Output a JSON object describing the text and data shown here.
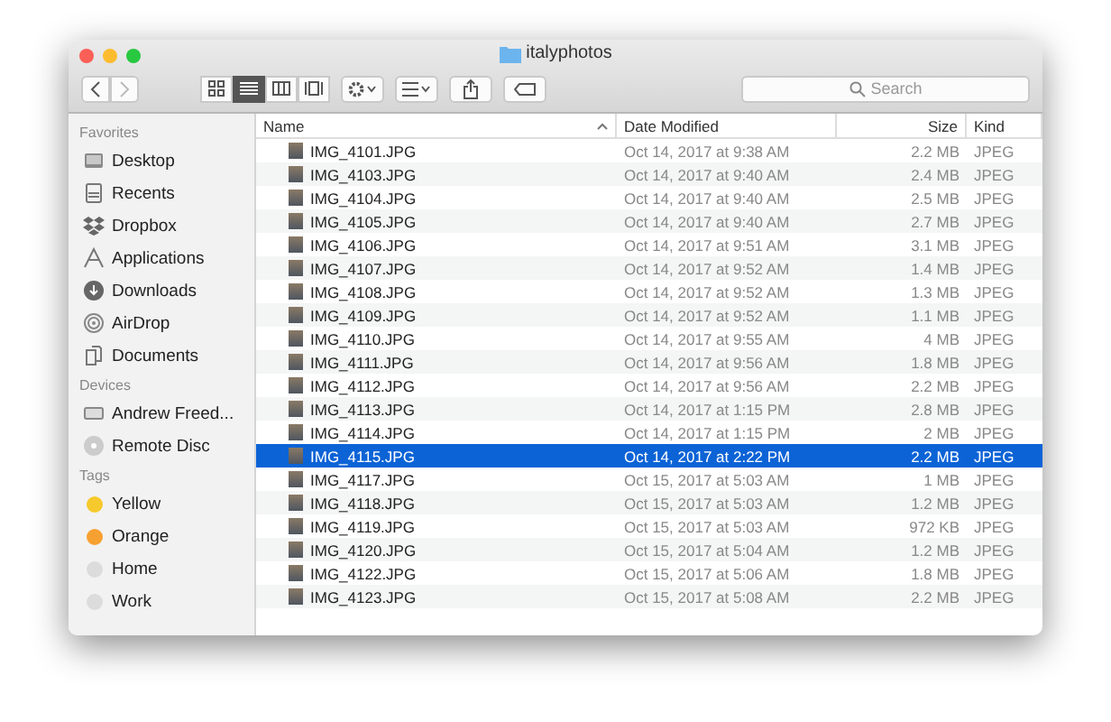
{
  "window": {
    "title": "italyphotos"
  },
  "toolbar": {
    "view_modes": [
      {
        "kind": "icons",
        "selected": false
      },
      {
        "kind": "list",
        "selected": true
      },
      {
        "kind": "columns",
        "selected": false
      },
      {
        "kind": "gallery",
        "selected": false
      }
    ],
    "search": {
      "placeholder": "Search"
    }
  },
  "sidebar": {
    "sections": [
      {
        "title": "Favorites",
        "items": [
          {
            "label": "Desktop",
            "kind": "desktop"
          },
          {
            "label": "Recents",
            "kind": "recents"
          },
          {
            "label": "Dropbox",
            "kind": "dropbox"
          },
          {
            "label": "Applications",
            "kind": "apps"
          },
          {
            "label": "Downloads",
            "kind": "downloads"
          },
          {
            "label": "AirDrop",
            "kind": "airdrop"
          },
          {
            "label": "Documents",
            "kind": "documents"
          }
        ]
      },
      {
        "title": "Devices",
        "items": [
          {
            "label": "Andrew Freed...",
            "kind": "laptop"
          },
          {
            "label": "Remote Disc",
            "kind": "disc"
          }
        ]
      },
      {
        "title": "Tags",
        "items": [
          {
            "label": "Yellow",
            "kind": "tag",
            "color": "#f6c92c"
          },
          {
            "label": "Orange",
            "kind": "tag",
            "color": "#f7a032"
          },
          {
            "label": "Home",
            "kind": "tag",
            "color": "#dcdcdc"
          },
          {
            "label": "Work",
            "kind": "tag",
            "color": "#dcdcdc"
          }
        ]
      }
    ]
  },
  "table": {
    "columns": [
      "Name",
      "Date Modified",
      "Size",
      "Kind"
    ],
    "rows": [
      {
        "name": "IMG_4101.JPG",
        "date": "Oct 14, 2017 at 9:38 AM",
        "size": "2.2 MB",
        "kind": "JPEG",
        "selected": false
      },
      {
        "name": "IMG_4103.JPG",
        "date": "Oct 14, 2017 at 9:40 AM",
        "size": "2.4 MB",
        "kind": "JPEG",
        "selected": false
      },
      {
        "name": "IMG_4104.JPG",
        "date": "Oct 14, 2017 at 9:40 AM",
        "size": "2.5 MB",
        "kind": "JPEG",
        "selected": false
      },
      {
        "name": "IMG_4105.JPG",
        "date": "Oct 14, 2017 at 9:40 AM",
        "size": "2.7 MB",
        "kind": "JPEG",
        "selected": false
      },
      {
        "name": "IMG_4106.JPG",
        "date": "Oct 14, 2017 at 9:51 AM",
        "size": "3.1 MB",
        "kind": "JPEG",
        "selected": false
      },
      {
        "name": "IMG_4107.JPG",
        "date": "Oct 14, 2017 at 9:52 AM",
        "size": "1.4 MB",
        "kind": "JPEG",
        "selected": false
      },
      {
        "name": "IMG_4108.JPG",
        "date": "Oct 14, 2017 at 9:52 AM",
        "size": "1.3 MB",
        "kind": "JPEG",
        "selected": false
      },
      {
        "name": "IMG_4109.JPG",
        "date": "Oct 14, 2017 at 9:52 AM",
        "size": "1.1 MB",
        "kind": "JPEG",
        "selected": false
      },
      {
        "name": "IMG_4110.JPG",
        "date": "Oct 14, 2017 at 9:55 AM",
        "size": "4 MB",
        "kind": "JPEG",
        "selected": false
      },
      {
        "name": "IMG_4111.JPG",
        "date": "Oct 14, 2017 at 9:56 AM",
        "size": "1.8 MB",
        "kind": "JPEG",
        "selected": false
      },
      {
        "name": "IMG_4112.JPG",
        "date": "Oct 14, 2017 at 9:56 AM",
        "size": "2.2 MB",
        "kind": "JPEG",
        "selected": false
      },
      {
        "name": "IMG_4113.JPG",
        "date": "Oct 14, 2017 at 1:15 PM",
        "size": "2.8 MB",
        "kind": "JPEG",
        "selected": false
      },
      {
        "name": "IMG_4114.JPG",
        "date": "Oct 14, 2017 at 1:15 PM",
        "size": "2 MB",
        "kind": "JPEG",
        "selected": false
      },
      {
        "name": "IMG_4115.JPG",
        "date": "Oct 14, 2017 at 2:22 PM",
        "size": "2.2 MB",
        "kind": "JPEG",
        "selected": true
      },
      {
        "name": "IMG_4117.JPG",
        "date": "Oct 15, 2017 at 5:03 AM",
        "size": "1 MB",
        "kind": "JPEG",
        "selected": false
      },
      {
        "name": "IMG_4118.JPG",
        "date": "Oct 15, 2017 at 5:03 AM",
        "size": "1.2 MB",
        "kind": "JPEG",
        "selected": false
      },
      {
        "name": "IMG_4119.JPG",
        "date": "Oct 15, 2017 at 5:03 AM",
        "size": "972 KB",
        "kind": "JPEG",
        "selected": false
      },
      {
        "name": "IMG_4120.JPG",
        "date": "Oct 15, 2017 at 5:04 AM",
        "size": "1.2 MB",
        "kind": "JPEG",
        "selected": false
      },
      {
        "name": "IMG_4122.JPG",
        "date": "Oct 15, 2017 at 5:06 AM",
        "size": "1.8 MB",
        "kind": "JPEG",
        "selected": false
      },
      {
        "name": "IMG_4123.JPG",
        "date": "Oct 15, 2017 at 5:08 AM",
        "size": "2.2 MB",
        "kind": "JPEG",
        "selected": false
      }
    ]
  }
}
